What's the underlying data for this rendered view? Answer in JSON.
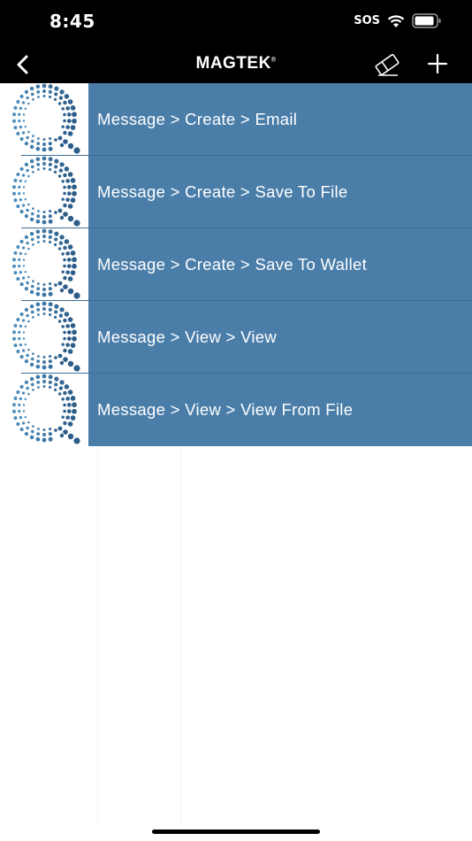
{
  "status": {
    "time": "8:45",
    "carrier": "SOS"
  },
  "nav": {
    "brand": "MAGTEK",
    "brand_mark": "®"
  },
  "items": [
    {
      "label": "Message > Create > Email"
    },
    {
      "label": "Message > Create > Save To File"
    },
    {
      "label": "Message > Create > Save To Wallet"
    },
    {
      "label": "Message > View > View"
    },
    {
      "label": "Message > View > View From File"
    }
  ],
  "icons": {
    "back": "chevron-left-icon",
    "clear": "eraser-icon",
    "add": "plus-icon",
    "thumb": "dotted-q-logo-icon"
  },
  "colors": {
    "row": "#4a7ea9",
    "header": "#000000",
    "dot_dark": "#2d5d8a",
    "dot_light": "#5aa2d0"
  }
}
